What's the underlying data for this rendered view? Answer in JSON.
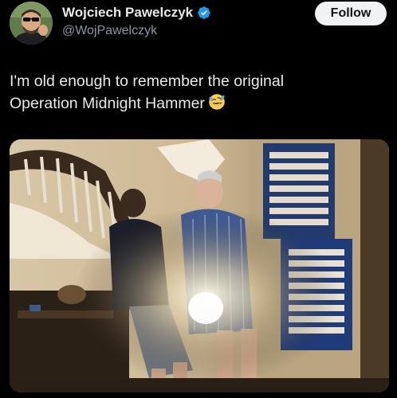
{
  "author": {
    "display_name": "Wojciech Pawelczyk",
    "handle": "@WojPawelczyk",
    "verified": true
  },
  "follow_button": {
    "label": "Follow"
  },
  "tweet": {
    "text_line_1": "I'm old enough to remember the original",
    "text_line_2": "Operation Midnight Hammer",
    "emoji": "rolling-on-the-floor-laughing"
  },
  "colors": {
    "background": "#000000",
    "text_primary": "#e7e9ea",
    "text_secondary": "#8b98a5",
    "verified": "#1d9bf0",
    "follow_bg": "#eff3f4"
  }
}
